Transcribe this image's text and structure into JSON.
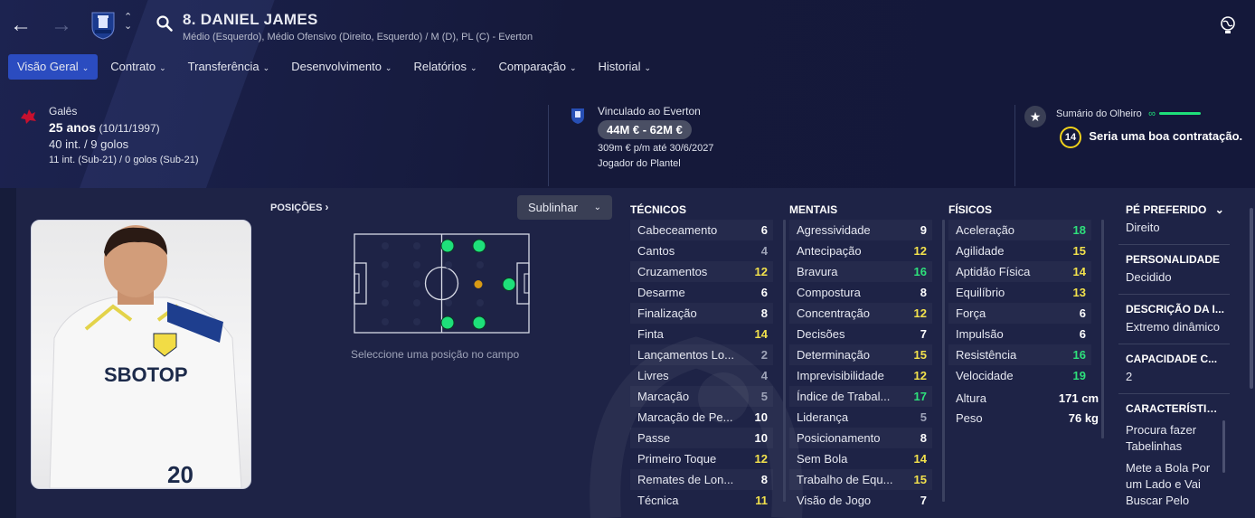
{
  "header": {
    "player_name": "8. DANIEL JAMES",
    "positions_line": "Médio (Esquerdo), Médio Ofensivo (Direito, Esquerdo) / M (D), PL (C) - Everton"
  },
  "tabs": [
    {
      "label": "Visão Geral",
      "active": true
    },
    {
      "label": "Contrato"
    },
    {
      "label": "Transferência"
    },
    {
      "label": "Desenvolvimento"
    },
    {
      "label": "Relatórios"
    },
    {
      "label": "Comparação"
    },
    {
      "label": "Historial"
    }
  ],
  "personal": {
    "nationality": "Galês",
    "age": "25 anos",
    "dob": "(10/11/1997)",
    "caps": "40 int. / 9 golos",
    "u21_caps": "11 int. (Sub-21) / 0 golos (Sub-21)"
  },
  "contract": {
    "club_line": "Vinculado ao Everton",
    "value": "44M € - 62M €",
    "wage": "309m € p/m até 30/6/2027",
    "status": "Jogador do Plantel"
  },
  "scout": {
    "title": "Sumário do Olheiro",
    "rating": "14",
    "verdict": "Seria uma boa contratação."
  },
  "positions_panel": {
    "title": "POSIÇÕES",
    "dropdown": "Sublinhar",
    "hint": "Seleccione uma posição no campo"
  },
  "technical": {
    "title": "TÉCNICOS",
    "rows": [
      {
        "name": "Cabeceamento",
        "value": "6",
        "color": "white"
      },
      {
        "name": "Cantos",
        "value": "4",
        "color": "grey"
      },
      {
        "name": "Cruzamentos",
        "value": "12",
        "color": "yellow"
      },
      {
        "name": "Desarme",
        "value": "6",
        "color": "white"
      },
      {
        "name": "Finalização",
        "value": "8",
        "color": "white"
      },
      {
        "name": "Finta",
        "value": "14",
        "color": "yellow"
      },
      {
        "name": "Lançamentos Lo...",
        "value": "2",
        "color": "grey"
      },
      {
        "name": "Livres",
        "value": "4",
        "color": "grey"
      },
      {
        "name": "Marcação",
        "value": "5",
        "color": "grey"
      },
      {
        "name": "Marcação de Pe...",
        "value": "10",
        "color": "white"
      },
      {
        "name": "Passe",
        "value": "10",
        "color": "white"
      },
      {
        "name": "Primeiro Toque",
        "value": "12",
        "color": "yellow"
      },
      {
        "name": "Remates de Lon...",
        "value": "8",
        "color": "white"
      },
      {
        "name": "Técnica",
        "value": "11",
        "color": "yellow"
      }
    ]
  },
  "mental": {
    "title": "MENTAIS",
    "rows": [
      {
        "name": "Agressividade",
        "value": "9",
        "color": "white"
      },
      {
        "name": "Antecipação",
        "value": "12",
        "color": "yellow"
      },
      {
        "name": "Bravura",
        "value": "16",
        "color": "green"
      },
      {
        "name": "Compostura",
        "value": "8",
        "color": "white"
      },
      {
        "name": "Concentração",
        "value": "12",
        "color": "yellow"
      },
      {
        "name": "Decisões",
        "value": "7",
        "color": "white"
      },
      {
        "name": "Determinação",
        "value": "15",
        "color": "yellow"
      },
      {
        "name": "Imprevisibilidade",
        "value": "12",
        "color": "yellow"
      },
      {
        "name": "Índice de Trabal...",
        "value": "17",
        "color": "green"
      },
      {
        "name": "Liderança",
        "value": "5",
        "color": "grey"
      },
      {
        "name": "Posicionamento",
        "value": "8",
        "color": "white"
      },
      {
        "name": "Sem Bola",
        "value": "14",
        "color": "yellow"
      },
      {
        "name": "Trabalho de Equ...",
        "value": "15",
        "color": "yellow"
      },
      {
        "name": "Visão de Jogo",
        "value": "7",
        "color": "white"
      }
    ]
  },
  "physical": {
    "title": "FÍSICOS",
    "rows": [
      {
        "name": "Aceleração",
        "value": "18",
        "color": "green"
      },
      {
        "name": "Agilidade",
        "value": "15",
        "color": "yellow"
      },
      {
        "name": "Aptidão Física",
        "value": "14",
        "color": "yellow"
      },
      {
        "name": "Equilíbrio",
        "value": "13",
        "color": "yellow"
      },
      {
        "name": "Força",
        "value": "6",
        "color": "white"
      },
      {
        "name": "Impulsão",
        "value": "6",
        "color": "white"
      },
      {
        "name": "Resistência",
        "value": "16",
        "color": "green"
      },
      {
        "name": "Velocidade",
        "value": "19",
        "color": "green"
      }
    ],
    "height_label": "Altura",
    "height_value": "171 cm",
    "weight_label": "Peso",
    "weight_value": "76 kg"
  },
  "side": {
    "foot_title": "PÉ PREFERIDO",
    "foot_value": "Direito",
    "personality_title": "PERSONALIDADE",
    "personality_value": "Decidido",
    "desc_title": "DESCRIÇÃO DA I...",
    "desc_value": "Extremo dinâmico",
    "capacity_title": "CAPACIDADE C...",
    "capacity_value": "2",
    "traits_title": "CARACTERÍSTIC...",
    "trait_1": "Procura fazer Tabelinhas",
    "trait_2": "Mete a Bola Por um Lado e Vai Buscar Pelo"
  },
  "photo": {
    "shirt_sponsor": "SBOTOP",
    "shirt_number": "20"
  },
  "colors": {
    "accent": "#2b4cc0",
    "rating_high": "#2ee07b",
    "rating_mid": "#f2e14c",
    "rating_low": "#9ea3b8"
  }
}
